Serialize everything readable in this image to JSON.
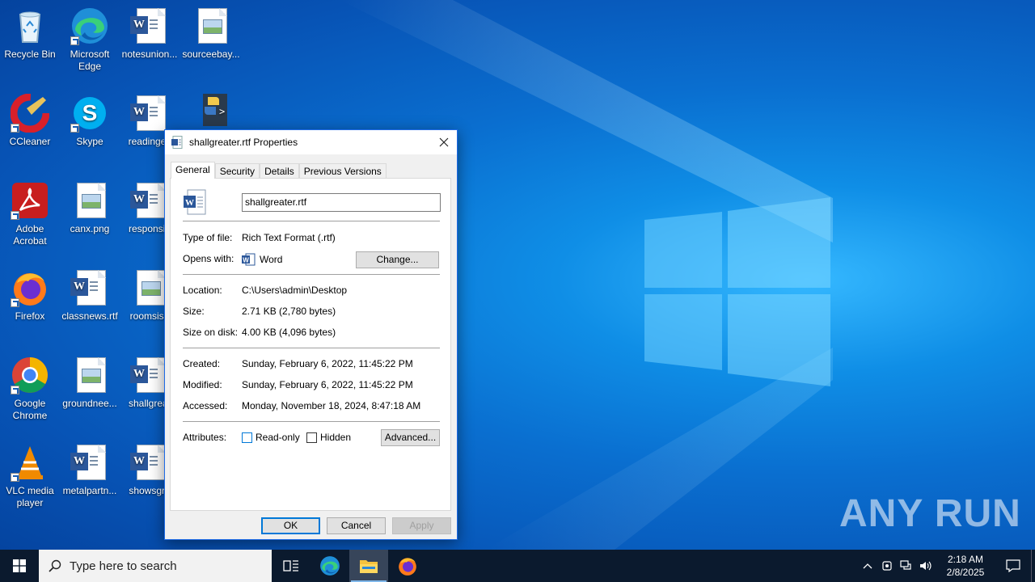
{
  "desktop": {
    "icons": [
      {
        "label": "Recycle Bin"
      },
      {
        "label": "Microsoft Edge"
      },
      {
        "label": "notesunion..."
      },
      {
        "label": "sourceebay..."
      },
      {
        "label": "CCleaner"
      },
      {
        "label": "Skype"
      },
      {
        "label": "readingex"
      },
      {
        "label": ""
      },
      {
        "label": "Adobe Acrobat"
      },
      {
        "label": "canx.png"
      },
      {
        "label": "responsib"
      },
      {
        "label": "Firefox"
      },
      {
        "label": "classnews.rtf"
      },
      {
        "label": "roomsisb"
      },
      {
        "label": "Google Chrome"
      },
      {
        "label": "groundnee..."
      },
      {
        "label": "shallgreat"
      },
      {
        "label": "VLC media player"
      },
      {
        "label": "metalpartn..."
      },
      {
        "label": "showsgra"
      }
    ]
  },
  "dialog": {
    "title": "shallgreater.rtf Properties",
    "tabs": [
      "General",
      "Security",
      "Details",
      "Previous Versions"
    ],
    "active_tab": "General",
    "file_name": "shallgreater.rtf",
    "type_label": "Type of file:",
    "type_value": "Rich Text Format (.rtf)",
    "opens_label": "Opens with:",
    "opens_value": "Word",
    "change_button": "Change...",
    "location_label": "Location:",
    "location_value": "C:\\Users\\admin\\Desktop",
    "size_label": "Size:",
    "size_value": "2.71 KB (2,780 bytes)",
    "size_disk_label": "Size on disk:",
    "size_disk_value": "4.00 KB (4,096 bytes)",
    "created_label": "Created:",
    "created_value": "Sunday, February 6, 2022, 11:45:22 PM",
    "modified_label": "Modified:",
    "modified_value": "Sunday, February 6, 2022, 11:45:22 PM",
    "accessed_label": "Accessed:",
    "accessed_value": "Monday, November 18, 2024, 8:47:18 AM",
    "attributes_label": "Attributes:",
    "readonly_label": "Read-only",
    "hidden_label": "Hidden",
    "advanced_button": "Advanced...",
    "ok_button": "OK",
    "cancel_button": "Cancel",
    "apply_button": "Apply"
  },
  "taskbar": {
    "search_placeholder": "Type here to search",
    "time": "2:18 AM",
    "date": "2/8/2025"
  },
  "watermark": "ANY RUN",
  "colors": {
    "accent": "#0078d7",
    "taskbar": "#0b1a2e",
    "word_blue": "#2b579a"
  }
}
